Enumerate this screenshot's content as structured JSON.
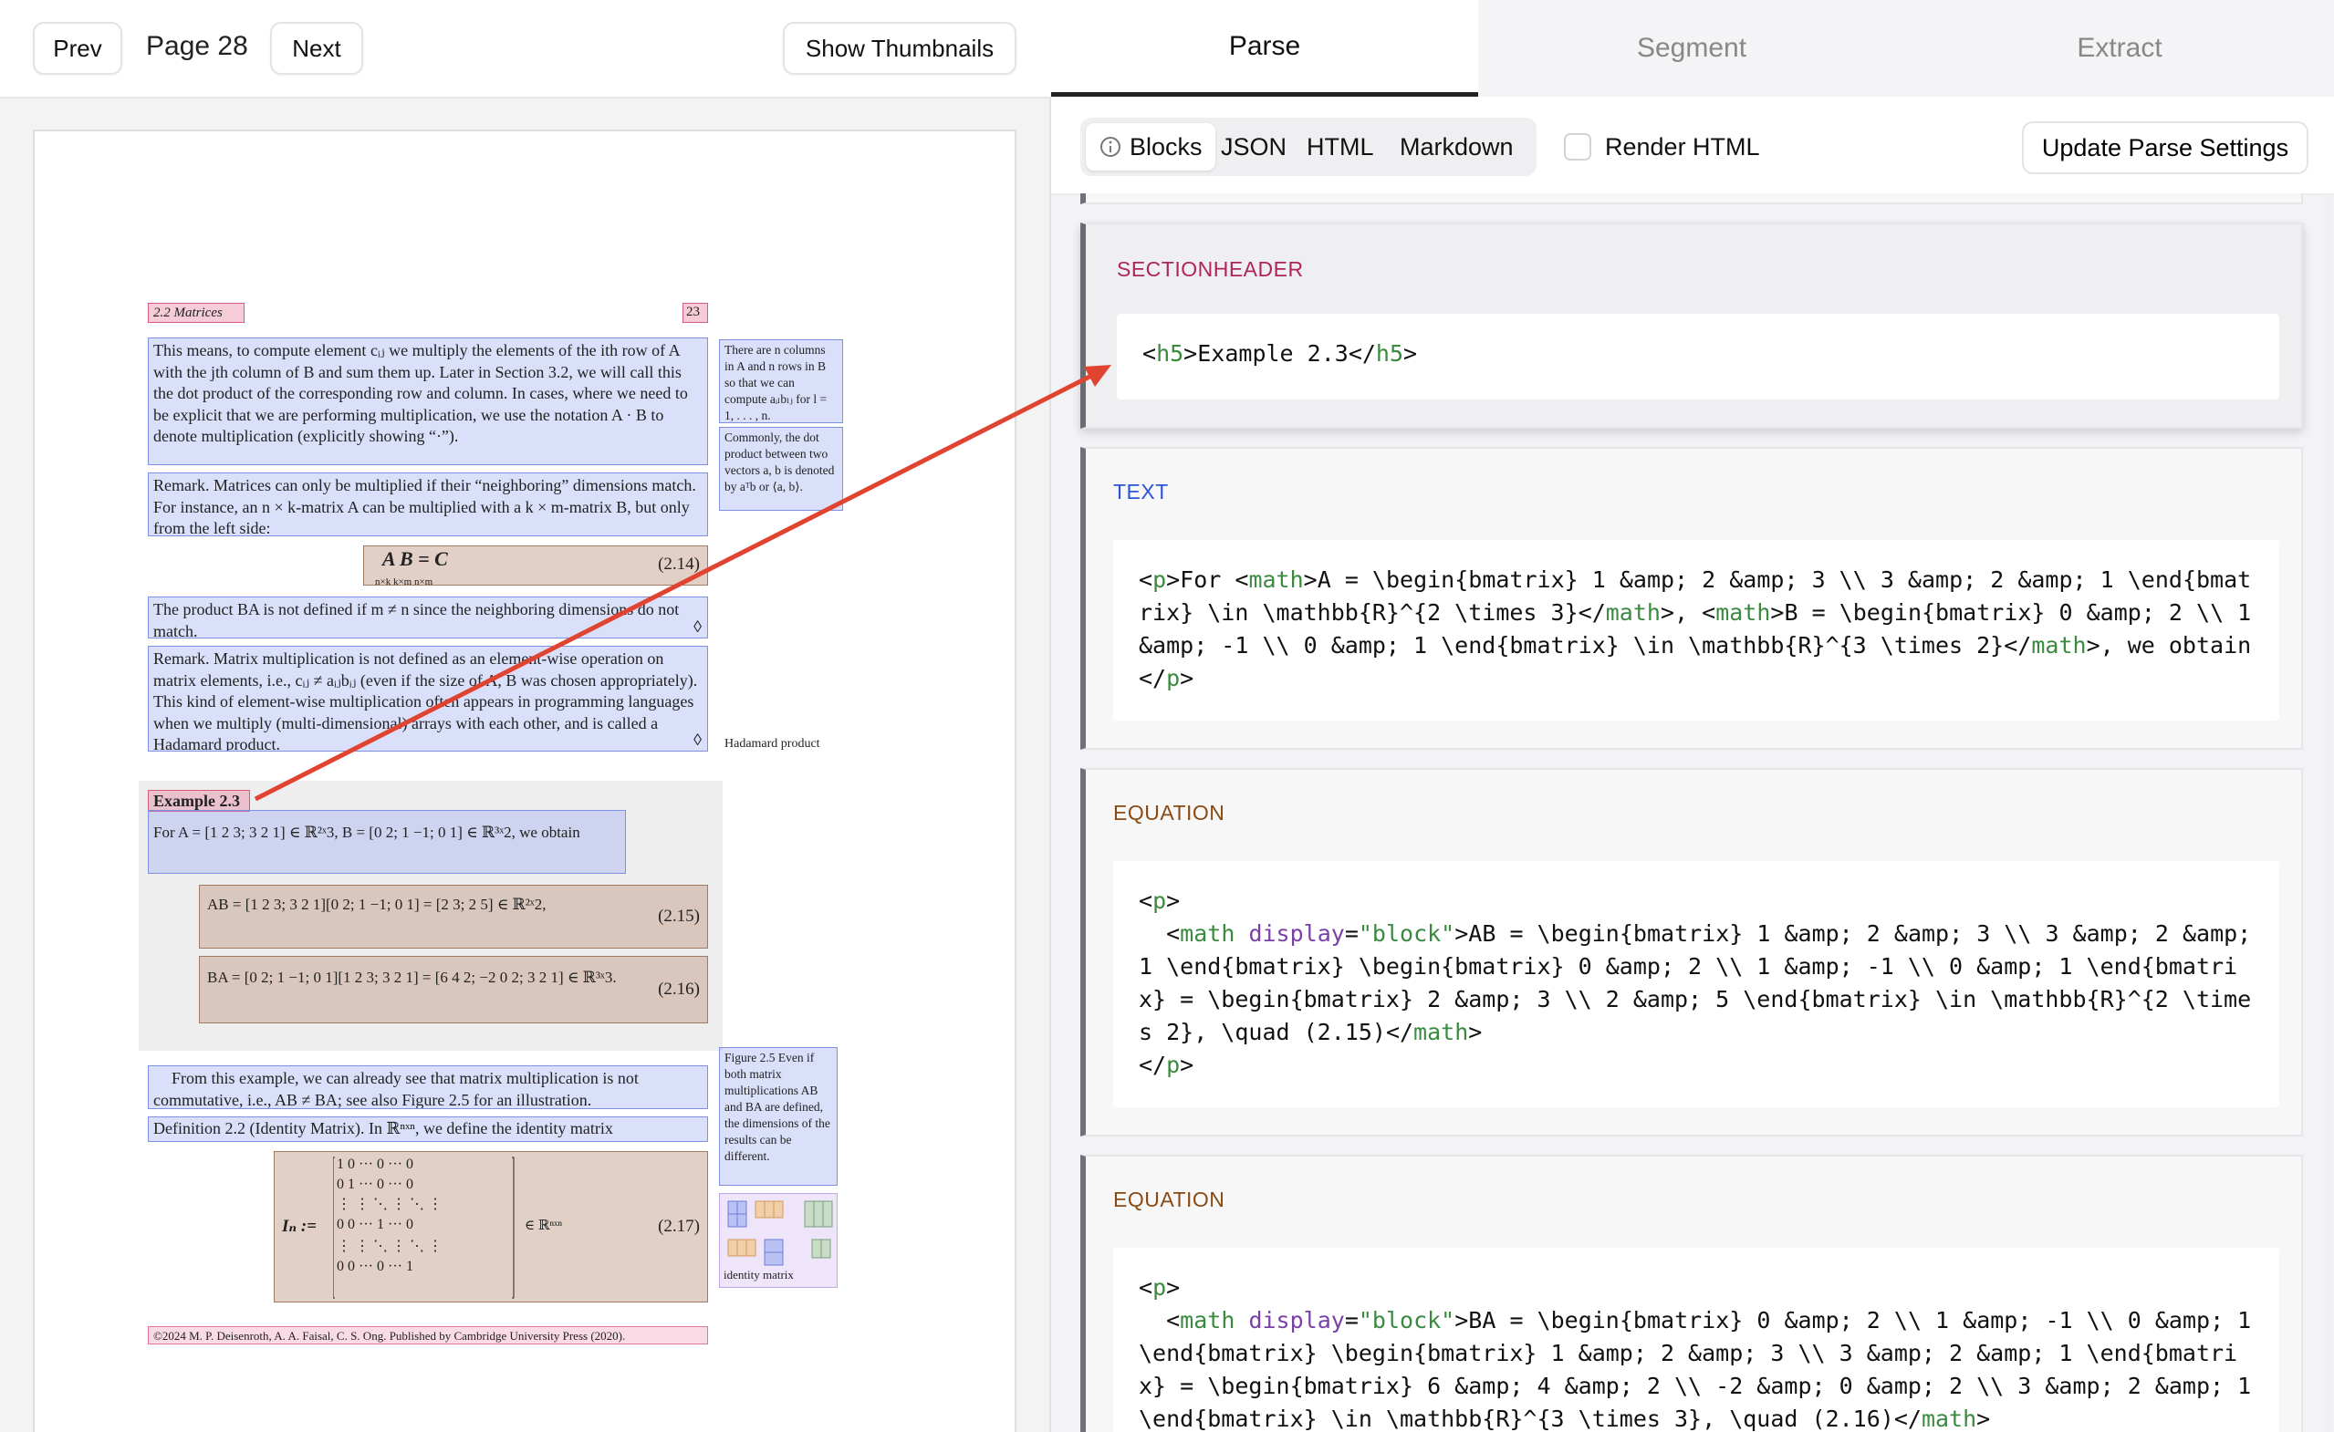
{
  "toolbar": {
    "prev": "Prev",
    "page_label": "Page 28",
    "next": "Next",
    "thumbs": "Show Thumbnails"
  },
  "doc": {
    "running_head": "2.2  Matrices",
    "page_no": "23",
    "para1": "This means, to compute element cᵢⱼ we multiply the elements of the ith row of A with the jth column of B and sum them up. Later in Section 3.2, we will call this the dot product of the corresponding row and column. In cases, where we need to be explicit that we are performing multiplication, we use the notation A · B to denote multiplication (explicitly showing “·”).",
    "side1": "There are n columns in A and n rows in B so that we can compute aᵢₗbₗⱼ for l = 1, . . . , n.",
    "side2": "Commonly, the dot product between two vectors a, b is denoted by aᵀb or ⟨a, b⟩.",
    "remark1": "Remark.  Matrices can only be multiplied if their “neighboring” dimensions match. For instance, an n × k-matrix A can be multiplied with a k × m-matrix B, but only from the left side:",
    "eq214_body": "A  B  =  C",
    "eq214_under": "n×k  k×m      n×m",
    "eq214_num": "(2.14)",
    "product_ba": "The product BA is not defined if m ≠ n since the neighboring dimensions do not match.",
    "diamond": "◊",
    "remark2": "Remark.  Matrix multiplication is not defined as an element-wise operation on matrix elements, i.e., cᵢⱼ ≠ aᵢⱼbᵢⱼ (even if the size of A, B was chosen appropriately). This kind of element-wise multiplication often appears in programming languages when we multiply (multi-dimensional) arrays with each other, and is called a Hadamard product.",
    "hadamard_label": "Hadamard product",
    "example_title": "Example 2.3",
    "example_text": "For A = [1 2 3; 3 2 1] ∈ ℝ²ˣ3, B = [0 2; 1 −1; 0 1] ∈ ℝ³ˣ2, we obtain",
    "eq215_body": "AB = [1 2 3; 3 2 1][0 2; 1 −1; 0 1] = [2 3; 2 5] ∈ ℝ²ˣ2,",
    "eq215_num": "(2.15)",
    "eq216_body": "BA = [0 2; 1 −1; 0 1][1 2 3; 3 2 1] = [6 4 2; −2 0 2; 3 2 1] ∈ ℝ³ˣ3.",
    "eq216_num": "(2.16)",
    "para_commute": "From this example, we can already see that matrix multiplication is not commutative, i.e., AB ≠ BA; see also Figure 2.5 for an illustration.",
    "figure_caption": "Figure 2.5  Even if both matrix multiplications AB and BA are defined, the dimensions of the results can be different.",
    "definition": "Definition 2.2 (Identity Matrix).  In ℝⁿˣⁿ, we define the identity matrix",
    "eq217_lhs": "Iₙ :=",
    "eq217_rhs": "∈ ℝⁿˣⁿ",
    "eq217_num": "(2.17)",
    "identity_label": "identity matrix",
    "footer": "©2024 M. P. Deisenroth, A. A. Faisal, C. S. Ong. Published by Cambridge University Press (2020)."
  },
  "tabs": {
    "parse": "Parse",
    "segment": "Segment",
    "extract": "Extract"
  },
  "views": {
    "blocks": "Blocks",
    "json": "JSON",
    "html": "HTML",
    "markdown": "Markdown",
    "render_html": "Render HTML",
    "update": "Update Parse Settings"
  },
  "blocks": [
    {
      "type": "SECTIONHEADER",
      "color": "#b0245b"
    },
    {
      "type": "TEXT",
      "color": "#2b55d6"
    },
    {
      "type": "EQUATION",
      "color": "#8a4a12"
    },
    {
      "type": "EQUATION",
      "color": "#8a4a12"
    }
  ],
  "code": {
    "b1_open": "<h5>",
    "b1_tag_open": "h5",
    "b1_text": "Example 2.3",
    "b1_tag_close": "h5",
    "b2_p": "p",
    "b2_math": "math",
    "b2_t1": "A = \\begin{bmatrix} 1 &amp; 2 &amp; 3 \\\\ 3 &amp; 2 &amp; 1 \\end{bmatrix} \\in \\mathbb{R}^{2 \\times 3}",
    "b2_t2": ", ",
    "b2_t3": "B = \\begin{bmatrix} 0 &amp; 2 \\\\ 1 &amp; -1 \\\\ 0 &amp; 1 \\end{bmatrix} \\in \\mathbb{R}^{3 \\times 2}",
    "b2_t4": ", we obtain",
    "display_attr": "display",
    "display_val": "\"block\"",
    "b3_t": "AB = \\begin{bmatrix} 1 &amp; 2 &amp; 3 \\\\ 3 &amp; 2 &amp; 1 \\end{bmatrix} \\begin{bmatrix} 0 &amp; 2 \\\\ 1 &amp; -1 \\\\ 0 &amp; 1 \\end{bmatrix} = \\begin{bmatrix} 2 &amp; 3 \\\\ 2 &amp; 5 \\end{bmatrix} \\in \\mathbb{R}^{2 \\times 2}, \\quad (2.15)",
    "b4_t": "BA = \\begin{bmatrix} 0 &amp; 2 \\\\ 1 &amp; -1 \\\\ 0 &amp; 1 \\end{bmatrix} \\begin{bmatrix} 1 &amp; 2 &amp; 3 \\\\ 3 &amp; 2 &amp; 1 \\end{bmatrix} = \\begin{bmatrix} 6 &amp; 4 &amp; 2 \\\\ -2 &amp; 0 &amp; 2 \\\\ 3 &amp; 2 &amp; 1 \\end{bmatrix} \\in \\mathbb{R}^{3 \\times 3}, \\quad (2.16)"
  },
  "colors": {
    "arrow": "#e0432f",
    "active_tab_underline": "#222222"
  }
}
